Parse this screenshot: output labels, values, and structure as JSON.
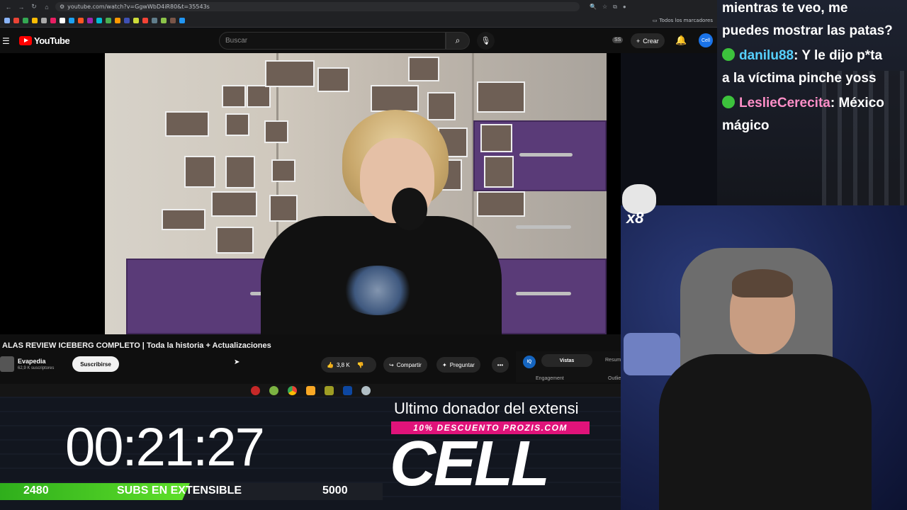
{
  "browser": {
    "url": "youtube.com/watch?v=GgwWbD4iR80&t=35543s",
    "bookmarks_folder": "Todos los marcadores"
  },
  "youtube": {
    "logo_text": "YouTube",
    "search_placeholder": "Buscar",
    "ss_badge": "SS",
    "create_label": "Crear",
    "avatar_text": "Cell"
  },
  "video": {
    "title": "ALAS REVIEW ICEBERG COMPLETO | Toda la historia + Actualizaciones",
    "channel_name": "Evapedia",
    "channel_subs": "62,9 K suscriptores",
    "subscribe_label": "Suscribirse",
    "likes": "3,8 K",
    "share_label": "Compartir",
    "ask_label": "Preguntar",
    "more_label": "•••"
  },
  "side_panel": {
    "iq_label": "IQ",
    "tab_active": "Vistas",
    "tab_other": "Resum",
    "metric1": "Engagement",
    "metric2": "Outlie"
  },
  "stream_overlay": {
    "timer": "00:21:27",
    "subs_current": "2480",
    "subs_label": "SUBS EN EXTENSIBLE",
    "subs_goal": "5000",
    "subs_progress": 0.496,
    "donor_label": "Ultimo donador del extensi",
    "promo": "10% DESCUENTO PROZIS.COM",
    "donor_name": "CELL"
  },
  "chat": {
    "line1": "mientras te veo, me",
    "line2": "puedes mostrar las patas?",
    "msg2_user": "danilu88",
    "msg2_text": ": Y le dijo p*ta",
    "msg2_cont": "a la víctima pinche yoss",
    "msg3_user": "LeslieCerecita",
    "msg3_text": ": México",
    "msg3_cont": "mágico"
  },
  "emote": {
    "multiplier": "x8"
  },
  "colors": {
    "youtube_red": "#ff0000",
    "subs_bar": "#3fbf20",
    "promo_pink": "#e0137a",
    "chat_user1": "#56d0ff",
    "chat_user2": "#ff8fc8"
  }
}
